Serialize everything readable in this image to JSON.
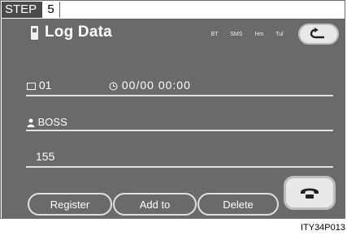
{
  "step": {
    "label": "STEP",
    "number": "5"
  },
  "header": {
    "title": "Log Data",
    "status": [
      "BT",
      "SMS",
      "Hm",
      "Tul"
    ],
    "back_icon": "back-arrow-icon"
  },
  "record": {
    "entry_number": "01",
    "datetime": "00/00 00:00",
    "name": "BOSS",
    "number": "155"
  },
  "buttons": {
    "register": "Register",
    "add_to": "Add to",
    "delete": "Delete"
  },
  "caption": "ITY34P013",
  "colors": {
    "screen_bg": "#6a6a6a",
    "button_face": "#e9e9e9",
    "rule": "#e0e0e0"
  }
}
